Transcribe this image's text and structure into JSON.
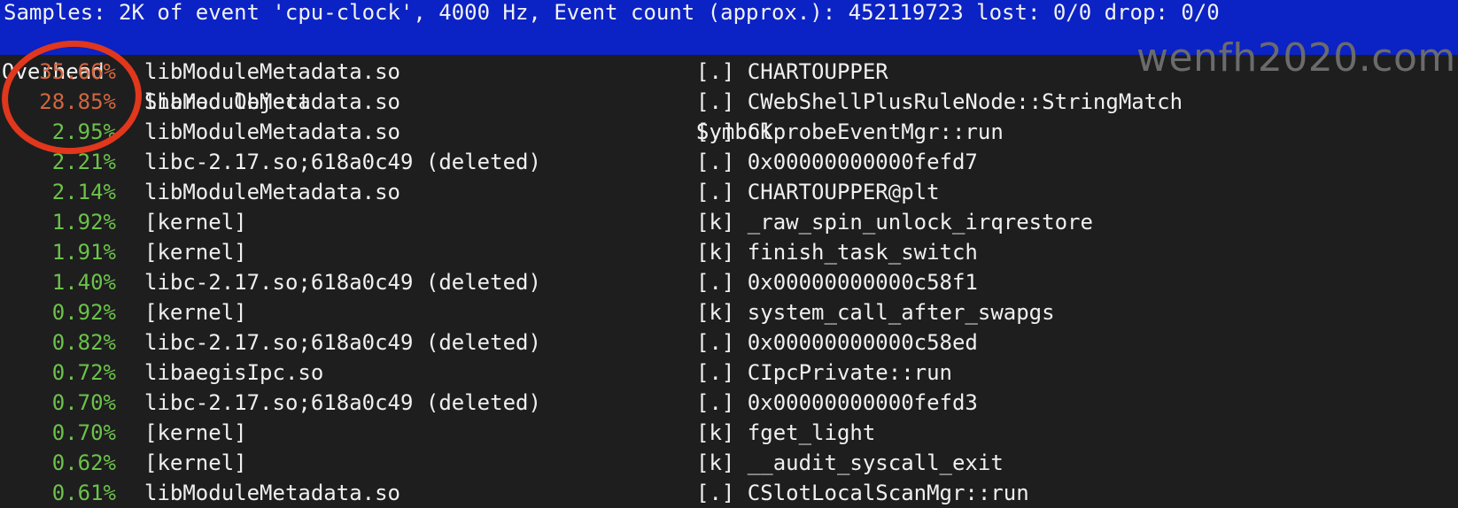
{
  "header": {
    "summary": "Samples: 2K of event 'cpu-clock', 4000 Hz, Event count (approx.): 452119723 lost: 0/0 drop: 0/0",
    "col_overhead": "Overhead",
    "col_shared_object": "Shared Object",
    "col_symbol": "Symbol"
  },
  "rows": [
    {
      "overhead": "35.66%",
      "object": "libModuleMetadata.so",
      "symbol": "[.] CHARTOUPPER"
    },
    {
      "overhead": "28.85%",
      "object": "libModuleMetadata.so",
      "symbol": "[.] CWebShellPlusRuleNode::StringMatch"
    },
    {
      "overhead": "2.95%",
      "object": "libModuleMetadata.so",
      "symbol": "[.] CKprobeEventMgr::run"
    },
    {
      "overhead": "2.21%",
      "object": "libc-2.17.so;618a0c49 (deleted)",
      "symbol": "[.] 0x00000000000fefd7"
    },
    {
      "overhead": "2.14%",
      "object": "libModuleMetadata.so",
      "symbol": "[.] CHARTOUPPER@plt"
    },
    {
      "overhead": "1.92%",
      "object": "[kernel]",
      "symbol": "[k] _raw_spin_unlock_irqrestore"
    },
    {
      "overhead": "1.91%",
      "object": "[kernel]",
      "symbol": "[k] finish_task_switch"
    },
    {
      "overhead": "1.40%",
      "object": "libc-2.17.so;618a0c49 (deleted)",
      "symbol": "[.] 0x00000000000c58f1"
    },
    {
      "overhead": "0.92%",
      "object": "[kernel]",
      "symbol": "[k] system_call_after_swapgs"
    },
    {
      "overhead": "0.82%",
      "object": "libc-2.17.so;618a0c49 (deleted)",
      "symbol": "[.] 0x00000000000c58ed"
    },
    {
      "overhead": "0.72%",
      "object": "libaegisIpc.so",
      "symbol": "[.] CIpcPrivate::run"
    },
    {
      "overhead": "0.70%",
      "object": "libc-2.17.so;618a0c49 (deleted)",
      "symbol": "[.] 0x00000000000fefd3"
    },
    {
      "overhead": "0.70%",
      "object": "[kernel]",
      "symbol": "[k] fget_light"
    },
    {
      "overhead": "0.62%",
      "object": "[kernel]",
      "symbol": "[k] __audit_syscall_exit"
    },
    {
      "overhead": "0.61%",
      "object": "libModuleMetadata.so",
      "symbol": "[.] CSlotLocalScanMgr::run"
    }
  ],
  "watermark": "wenfh2020.com",
  "colors": {
    "header_bg": "#0b22c4",
    "hot_percent": "#d4663f",
    "normal_percent": "#6cc24a",
    "annotation_circle": "#e1371c"
  }
}
